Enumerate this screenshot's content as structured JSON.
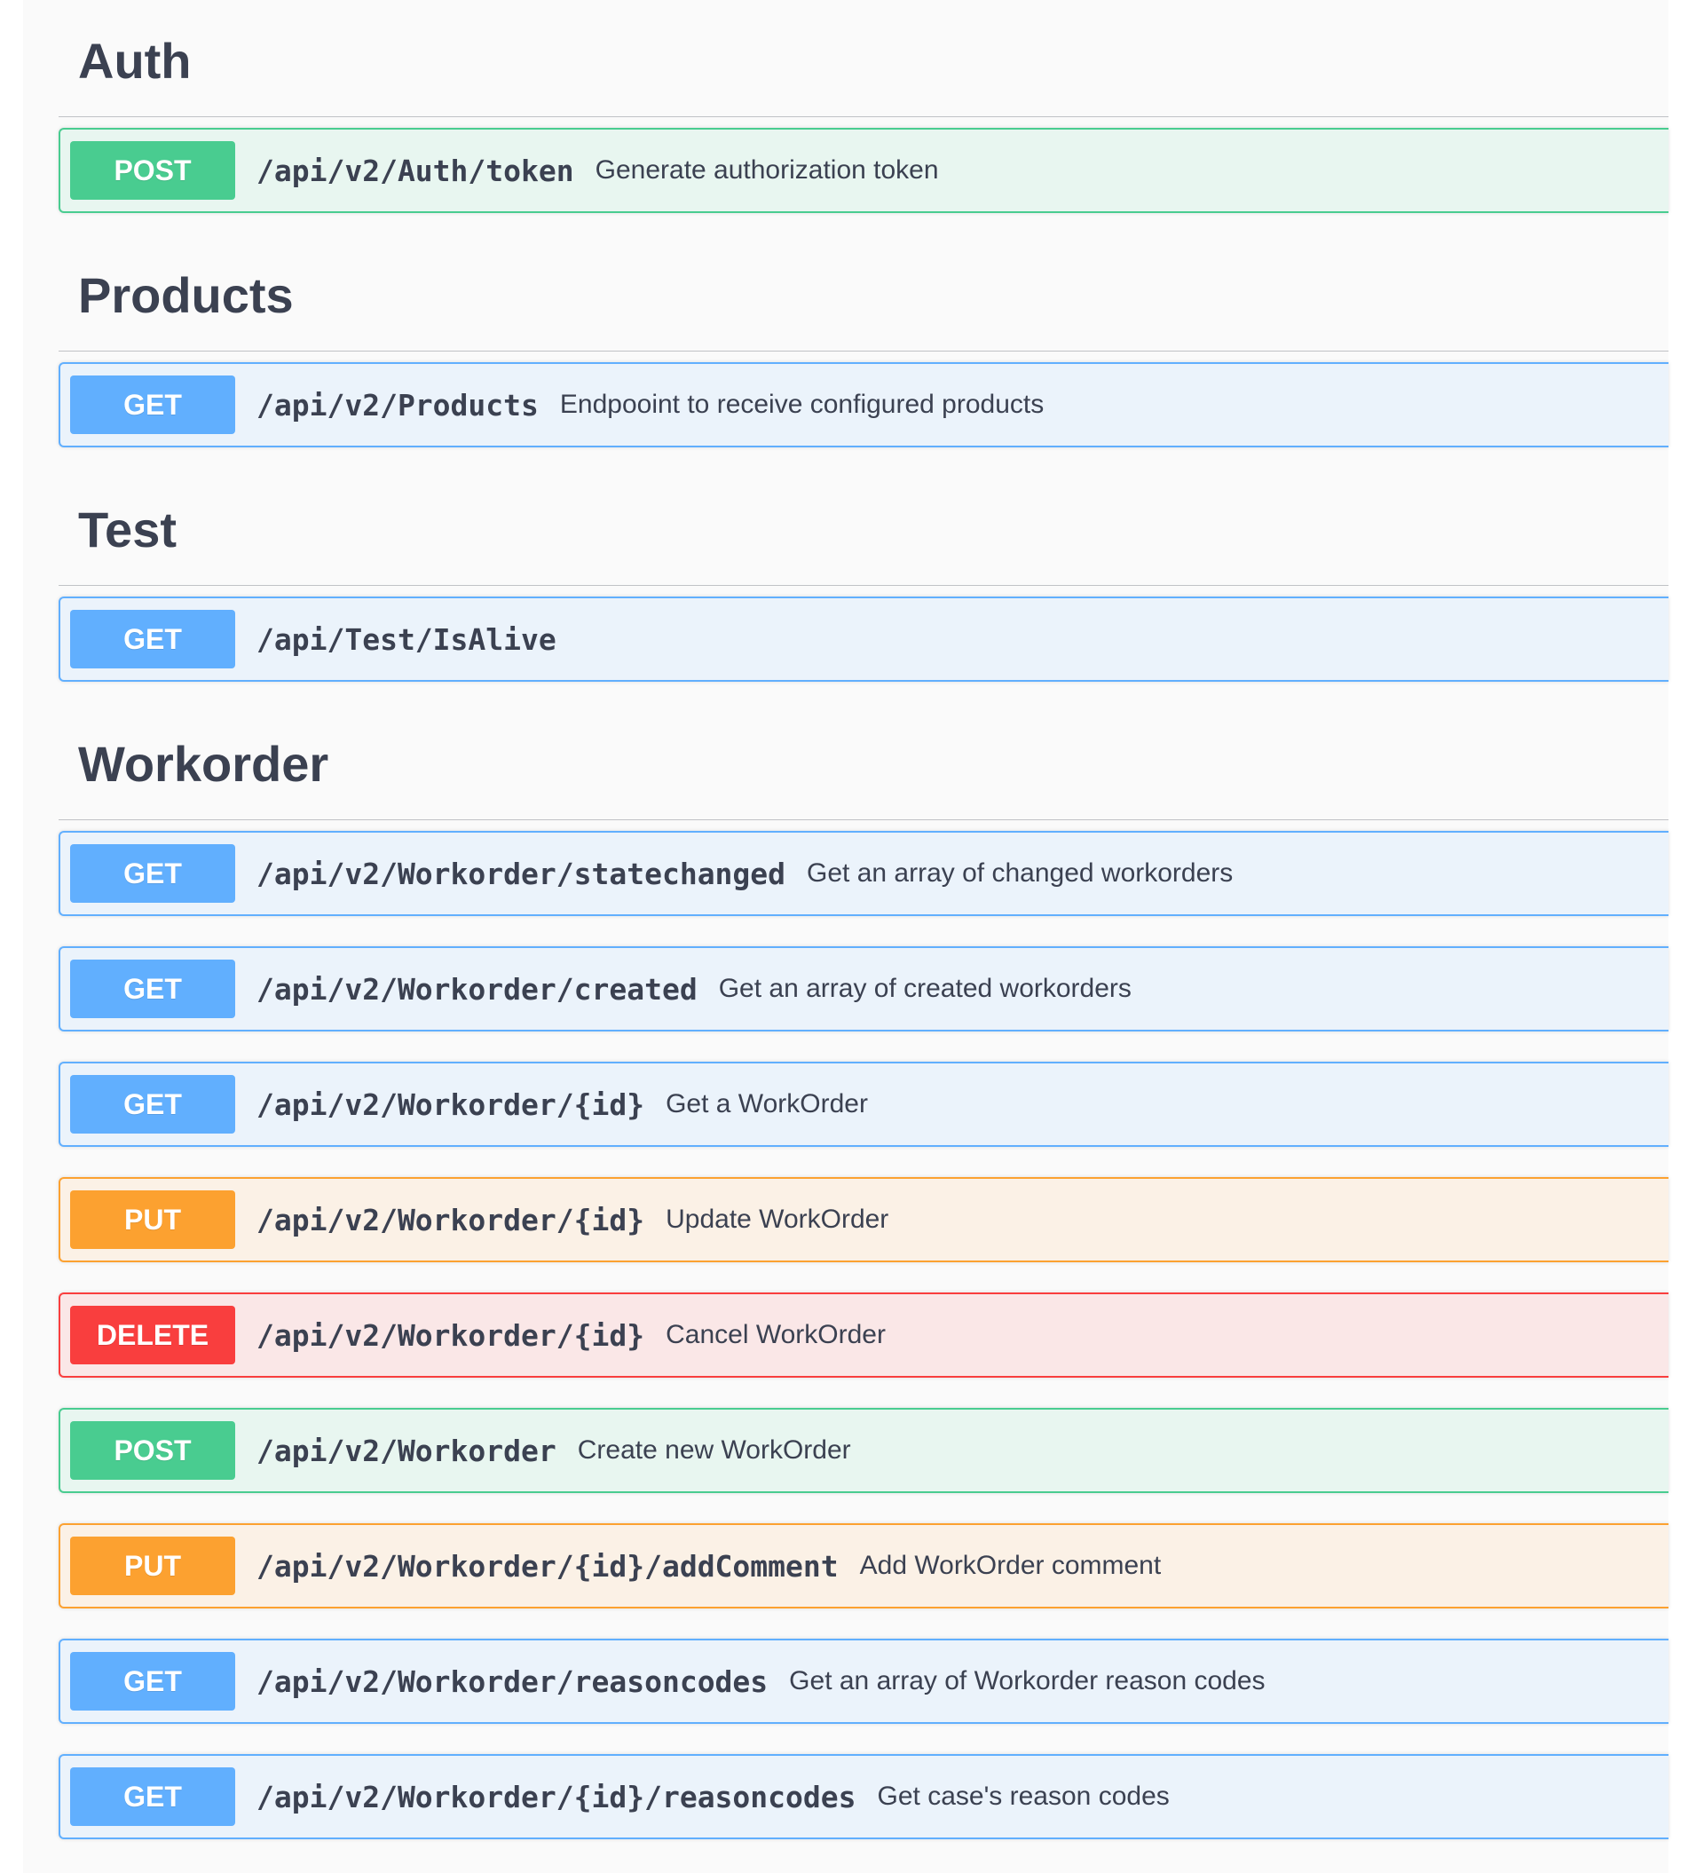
{
  "sections": [
    {
      "title": "Auth",
      "ops": [
        {
          "method": "POST",
          "kind": "post",
          "path": "/api/v2/Auth/token",
          "summary": "Generate authorization token"
        }
      ]
    },
    {
      "title": "Products",
      "ops": [
        {
          "method": "GET",
          "kind": "get",
          "path": "/api/v2/Products",
          "summary": "Endpooint to receive configured products"
        }
      ]
    },
    {
      "title": "Test",
      "ops": [
        {
          "method": "GET",
          "kind": "get",
          "path": "/api/Test/IsAlive",
          "summary": ""
        }
      ]
    },
    {
      "title": "Workorder",
      "ops": [
        {
          "method": "GET",
          "kind": "get",
          "path": "/api/v2/Workorder/statechanged",
          "summary": "Get an array of changed workorders"
        },
        {
          "method": "GET",
          "kind": "get",
          "path": "/api/v2/Workorder/created",
          "summary": "Get an array of created workorders"
        },
        {
          "method": "GET",
          "kind": "get",
          "path": "/api/v2/Workorder/{id}",
          "summary": "Get a WorkOrder"
        },
        {
          "method": "PUT",
          "kind": "put",
          "path": "/api/v2/Workorder/{id}",
          "summary": "Update WorkOrder"
        },
        {
          "method": "DELETE",
          "kind": "delete",
          "path": "/api/v2/Workorder/{id}",
          "summary": "Cancel WorkOrder"
        },
        {
          "method": "POST",
          "kind": "post",
          "path": "/api/v2/Workorder",
          "summary": "Create new WorkOrder"
        },
        {
          "method": "PUT",
          "kind": "put",
          "path": "/api/v2/Workorder/{id}/addComment",
          "summary": "Add WorkOrder comment"
        },
        {
          "method": "GET",
          "kind": "get",
          "path": "/api/v2/Workorder/reasoncodes",
          "summary": "Get an array of Workorder reason codes"
        },
        {
          "method": "GET",
          "kind": "get",
          "path": "/api/v2/Workorder/{id}/reasoncodes",
          "summary": "Get case's reason codes"
        }
      ]
    }
  ],
  "method_colors": {
    "get": "#61affe",
    "post": "#49cc90",
    "put": "#fca130",
    "delete": "#f93e3e"
  }
}
